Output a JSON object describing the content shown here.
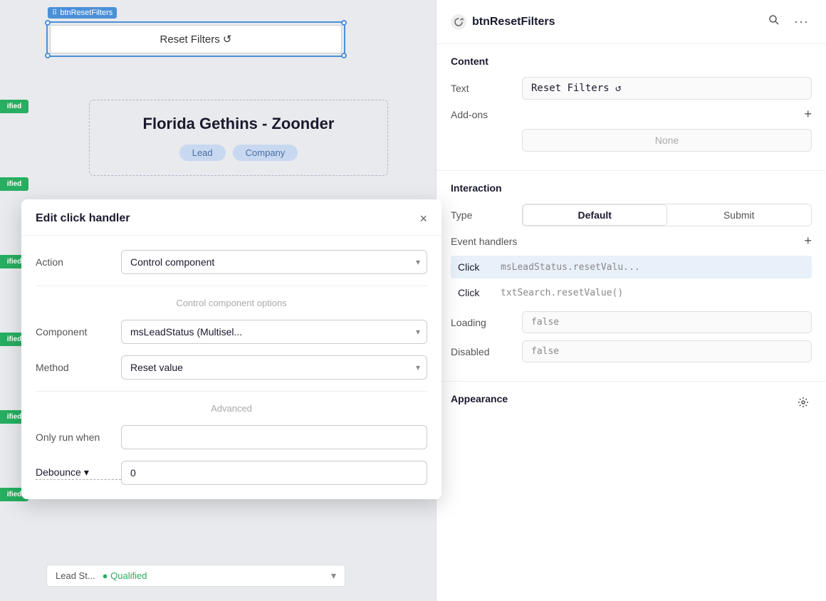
{
  "canvas": {
    "reset_button_label": "Reset Filters ↺",
    "component_label": "btnResetFilters",
    "card_title": "Florida Gethins - Zoonder",
    "badge1": "Lead",
    "badge2": "Company",
    "status_labels": [
      "ified",
      "ified",
      "ified",
      "ified",
      "ified"
    ],
    "bottom_lead_status": "Lead St...",
    "bottom_status_value": "● Qualified"
  },
  "modal": {
    "title": "Edit click handler",
    "close_icon": "×",
    "action_label": "Action",
    "action_value": "Control component",
    "section_label": "Control component options",
    "component_label": "Component",
    "component_value": "msLeadStatus (Multisel...",
    "method_label": "Method",
    "method_value": "Reset value",
    "advanced_label": "Advanced",
    "only_run_label": "Only run when",
    "only_run_value": "",
    "debounce_label": "Debounce",
    "debounce_chevron": "▾",
    "debounce_value": "0"
  },
  "right_panel": {
    "title": "btnResetFilters",
    "search_icon": "🔍",
    "more_icon": "···",
    "content_section": "Content",
    "text_label": "Text",
    "text_value": "Reset Filters ↺",
    "addons_label": "Add-ons",
    "addons_add_icon": "+",
    "addons_none": "None",
    "interaction_section": "Interaction",
    "type_label": "Type",
    "type_default": "Default",
    "type_submit": "Submit",
    "event_handlers_label": "Event handlers",
    "event_add_icon": "+",
    "events": [
      {
        "type": "Click",
        "action": "msLeadStatus.resetValu..."
      },
      {
        "type": "Click",
        "action": "txtSearch.resetValue()"
      }
    ],
    "loading_label": "Loading",
    "loading_value": "false",
    "disabled_label": "Disabled",
    "disabled_value": "false",
    "appearance_label": "Appearance",
    "appearance_icon": "⚙"
  }
}
